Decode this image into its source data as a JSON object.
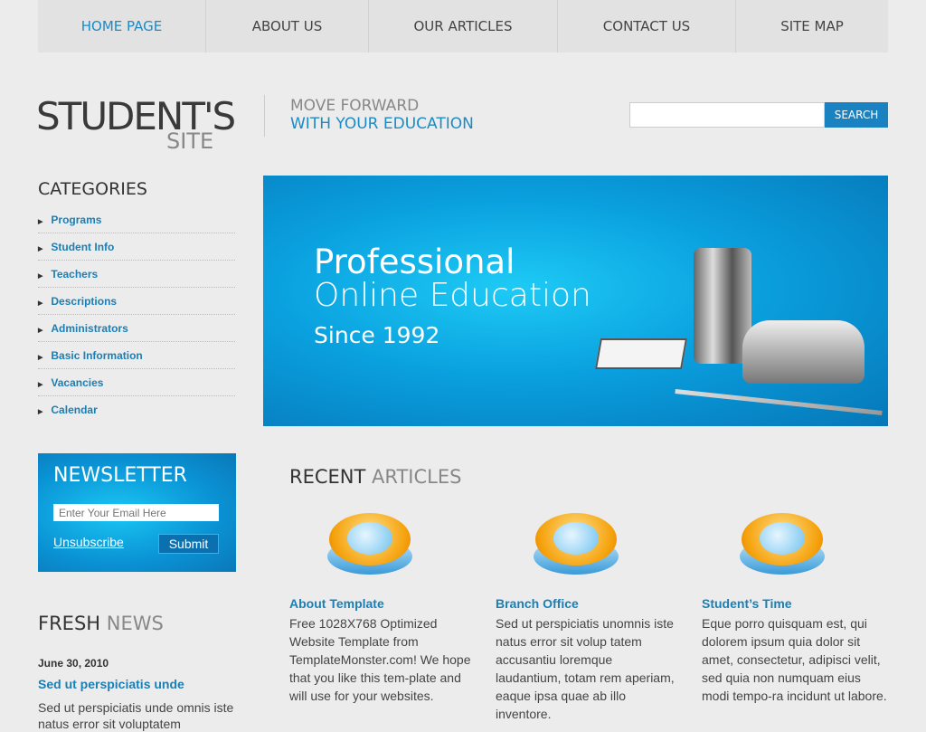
{
  "nav": [
    {
      "label": "HOME PAGE",
      "active": true
    },
    {
      "label": "ABOUT US"
    },
    {
      "label": "OUR ARTICLES"
    },
    {
      "label": "CONTACT US"
    },
    {
      "label": "SITE MAP"
    }
  ],
  "logo": {
    "line1": "STUDENT'S",
    "line2": "SITE"
  },
  "tagline": {
    "line1": "MOVE FORWARD",
    "line2": "WITH YOUR EDUCATION"
  },
  "search": {
    "value": "",
    "button": "SEARCH"
  },
  "categories": {
    "title": "CATEGORIES",
    "items": [
      "Programs",
      "Student Info",
      "Teachers",
      "Descriptions",
      "Administrators",
      "Basic Information",
      "Vacancies",
      "Calendar"
    ]
  },
  "banner": {
    "line1": "Professional",
    "line2": "Online Education",
    "line3": "Since 1992"
  },
  "newsletter": {
    "title": "NEWSLETTER",
    "placeholder": "Enter Your Email Here",
    "unsubscribe": "Unsubscribe",
    "submit": "Submit"
  },
  "fresh_news": {
    "title_a": "FRESH",
    "title_b": "NEWS",
    "date": "June 30, 2010",
    "headline": "Sed ut perspiciatis unde",
    "text": "Sed ut perspiciatis unde omnis iste natus error sit voluptatem"
  },
  "recent": {
    "title_a": "RECENT",
    "title_b": "ARTICLES",
    "articles": [
      {
        "icon": "pie-chart-icon",
        "title": "About Template",
        "text": "Free 1028X768 Optimized Website Template from TemplateMonster.com! We hope that you like this tem-plate and will use for your websites."
      },
      {
        "icon": "globe-icon",
        "title": "Branch Office",
        "text": "Sed ut perspiciatis unomnis iste natus error sit volup tatem accusantiu loremque laudantium, totam rem aperiam, eaque ipsa quae ab illo inventore."
      },
      {
        "icon": "clock-icon",
        "title": "Student’s Time",
        "text": "Eque porro quisquam est, qui dolorem ipsum quia dolor sit amet, consectetur, adipisci velit, sed quia non numquam eius modi tempo-ra incidunt ut labore."
      }
    ]
  },
  "colors": {
    "accent": "#1a8bc6",
    "background": "#ececec"
  }
}
